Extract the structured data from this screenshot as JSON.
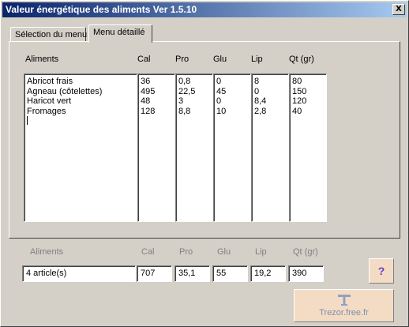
{
  "window": {
    "title": "Valeur énergétique des aliments Ver 1.5.10",
    "close_label": "X"
  },
  "tabs": [
    {
      "label": "Sélection du menu",
      "active": false
    },
    {
      "label": "Menu détaillé",
      "active": true
    }
  ],
  "detail": {
    "headers": {
      "aliments": "Aliments",
      "cal": "Cal",
      "pro": "Pro",
      "glu": "Glu",
      "lip": "Lip",
      "qt": "Qt (gr)"
    },
    "rows": [
      {
        "aliment": "Abricot frais",
        "cal": "36",
        "pro": "0,8",
        "glu": "0",
        "lip": "8",
        "qt": "80"
      },
      {
        "aliment": "Agneau (côtelettes)",
        "cal": "495",
        "pro": "22,5",
        "glu": "45",
        "lip": "0",
        "qt": "150"
      },
      {
        "aliment": "Haricot vert",
        "cal": "48",
        "pro": "3",
        "glu": "0",
        "lip": "8,4",
        "qt": "120"
      },
      {
        "aliment": "Fromages",
        "cal": "128",
        "pro": "8,8",
        "glu": "10",
        "lip": "2,8",
        "qt": "40"
      }
    ]
  },
  "totals": {
    "headers": {
      "aliments": "Aliments",
      "cal": "Cal",
      "pro": "Pro",
      "glu": "Glu",
      "lip": "Lip",
      "qt": "Qt (gr)"
    },
    "aliments": "4 article(s)",
    "cal": "707",
    "pro": "35,1",
    "glu": "55",
    "lip": "19,2",
    "qt": "390"
  },
  "help_button": {
    "label": "?"
  },
  "brand": {
    "text": "Trezor.free.fr",
    "icon": "t-logo-icon"
  },
  "colors": {
    "titlebar_start": "#0a246a",
    "titlebar_end": "#a6caf0",
    "button_bg": "#f4dcc4",
    "help_text": "#6a3ec8",
    "brand_text": "#7a8fb0"
  }
}
